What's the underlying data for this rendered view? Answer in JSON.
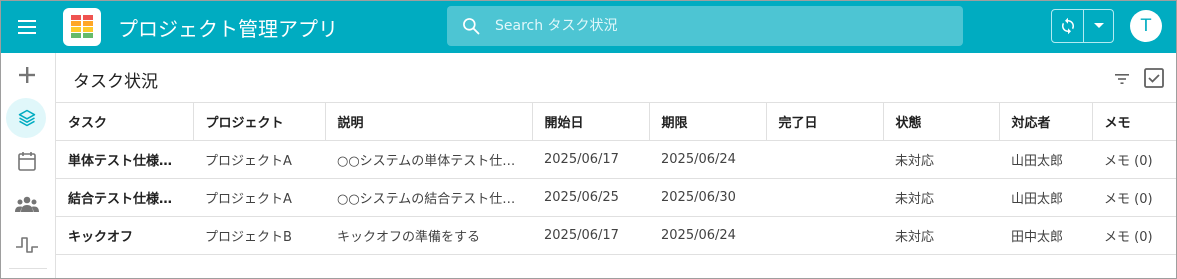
{
  "app": {
    "title": "プロジェクト管理アプリ",
    "search_placeholder": "Search タスク状況",
    "avatar_initial": "T",
    "accent_color": "#00acc1"
  },
  "rail": {
    "items": [
      {
        "icon": "plus-icon"
      },
      {
        "icon": "layers-icon",
        "active": true
      },
      {
        "icon": "calendar-icon"
      },
      {
        "icon": "people-icon"
      },
      {
        "icon": "pulse-icon"
      }
    ]
  },
  "page": {
    "title": "タスク状況"
  },
  "table": {
    "headers": [
      "タスク",
      "プロジェクト",
      "説明",
      "開始日",
      "期限",
      "完了日",
      "状態",
      "対応者",
      "メモ"
    ],
    "rows": [
      [
        "単体テスト仕様書作成",
        "プロジェクトA",
        "○○システムの単体テスト仕様書を作成",
        "2025/06/17",
        "2025/06/24",
        "",
        "未対応",
        "山田太郎",
        "メモ (0)"
      ],
      [
        "結合テスト仕様書作成",
        "プロジェクトA",
        "○○システムの結合テスト仕様書を作成",
        "2025/06/25",
        "2025/06/30",
        "",
        "未対応",
        "山田太郎",
        "メモ (0)"
      ],
      [
        "キックオフ",
        "プロジェクトB",
        "キックオフの準備をする",
        "2025/06/17",
        "2025/06/24",
        "",
        "未対応",
        "田中太郎",
        "メモ (0)"
      ]
    ]
  }
}
